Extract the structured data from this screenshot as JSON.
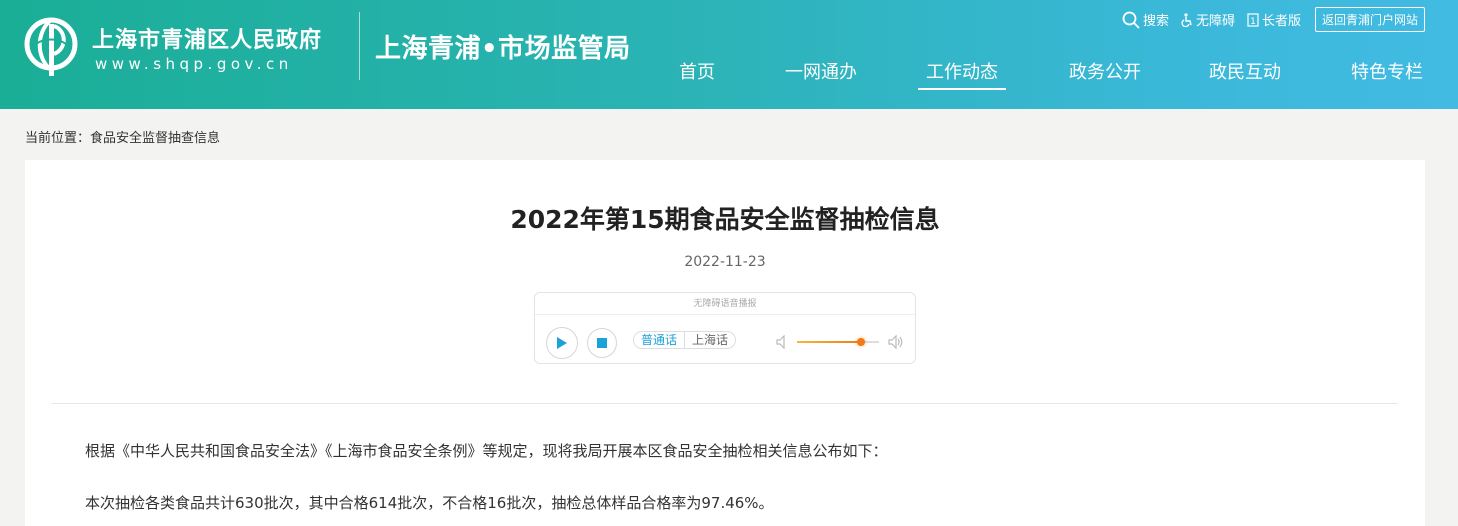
{
  "header": {
    "gov_name": "上海市青浦区人民政府",
    "gov_url": "www.shqp.gov.cn",
    "bureau_name": "上海青浦•市场监管局",
    "top_links": {
      "search": "搜索",
      "accessibility": "无障碍",
      "elder": "长者版",
      "portal": "返回青浦门户网站"
    },
    "nav": [
      {
        "label": "首页"
      },
      {
        "label": "一网通办"
      },
      {
        "label": "工作动态",
        "active": true
      },
      {
        "label": "政务公开"
      },
      {
        "label": "政民互动"
      },
      {
        "label": "特色专栏"
      }
    ]
  },
  "breadcrumb": {
    "prefix": "当前位置：",
    "current": "食品安全监督抽查信息"
  },
  "article": {
    "title": "2022年第15期食品安全监督抽检信息",
    "date": "2022-11-23",
    "player": {
      "label": "无障碍语音播报",
      "lang_mandarin": "普通话",
      "lang_shanghai": "上海话",
      "volume": 0.78
    },
    "paragraphs": [
      "根据《中华人民共和国食品安全法》《上海市食品安全条例》等规定，现将我局开展本区食品安全抽检相关信息公布如下：",
      "本次抽检各类食品共计630批次，其中合格614批次，不合格16批次，抽检总体样品合格率为97.46%。"
    ]
  },
  "colors": {
    "header_start": "#1aae96",
    "header_end": "#42bbe3",
    "accent_blue": "#1ba2d8",
    "volume_orange": "#f37a15"
  }
}
